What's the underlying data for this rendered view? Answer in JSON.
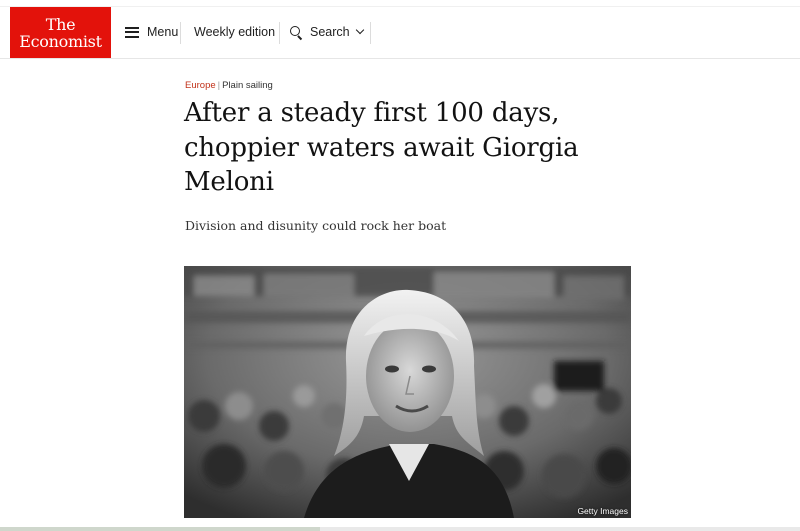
{
  "masthead": {
    "logo_line1": "The",
    "logo_line2": "Economist",
    "brand_color": "#e3120b"
  },
  "nav": {
    "menu_label": "Menu",
    "weekly_label": "Weekly edition",
    "search_label": "Search"
  },
  "article": {
    "section": "Europe",
    "separator": "|",
    "flytitle": "Plain sailing",
    "headline": "After a steady first 100 days, choppier waters await Giorgia Meloni",
    "subheadline": "Division and disunity could rock her boat",
    "image": {
      "credit": "Getty Images",
      "style": "black-and-white portrait"
    }
  },
  "icons": {
    "menu": "hamburger-icon",
    "search": "search-icon",
    "dropdown": "chevron-down-icon"
  }
}
